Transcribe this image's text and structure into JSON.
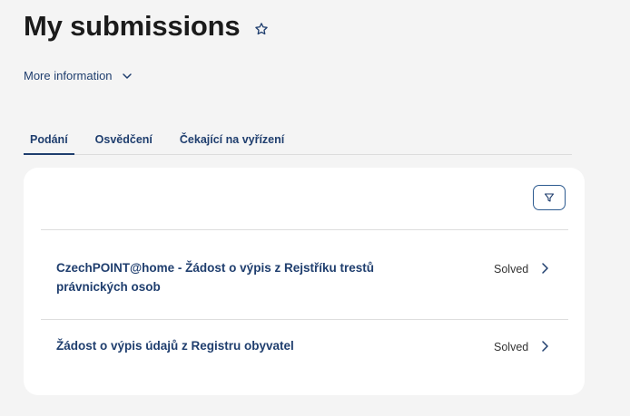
{
  "header": {
    "title": "My submissions",
    "star_icon": "star-outline-icon"
  },
  "more_info": {
    "label": "More information",
    "icon": "chevron-down-icon"
  },
  "tabs": [
    {
      "label": "Podání",
      "active": true
    },
    {
      "label": "Osvědčení",
      "active": false
    },
    {
      "label": "Čekající na vyřízení",
      "active": false
    }
  ],
  "card": {
    "filter_icon": "filter-icon",
    "items": [
      {
        "title": "CzechPOINT@home - Žádost o výpis z Rejstříku trestů právnických osob",
        "status": "Solved"
      },
      {
        "title": "Žádost o výpis údajů z Registru obyvatel",
        "status": "Solved"
      }
    ]
  },
  "colors": {
    "accent": "#1f3e6e",
    "background": "#f4f4f4",
    "card": "#ffffff"
  }
}
